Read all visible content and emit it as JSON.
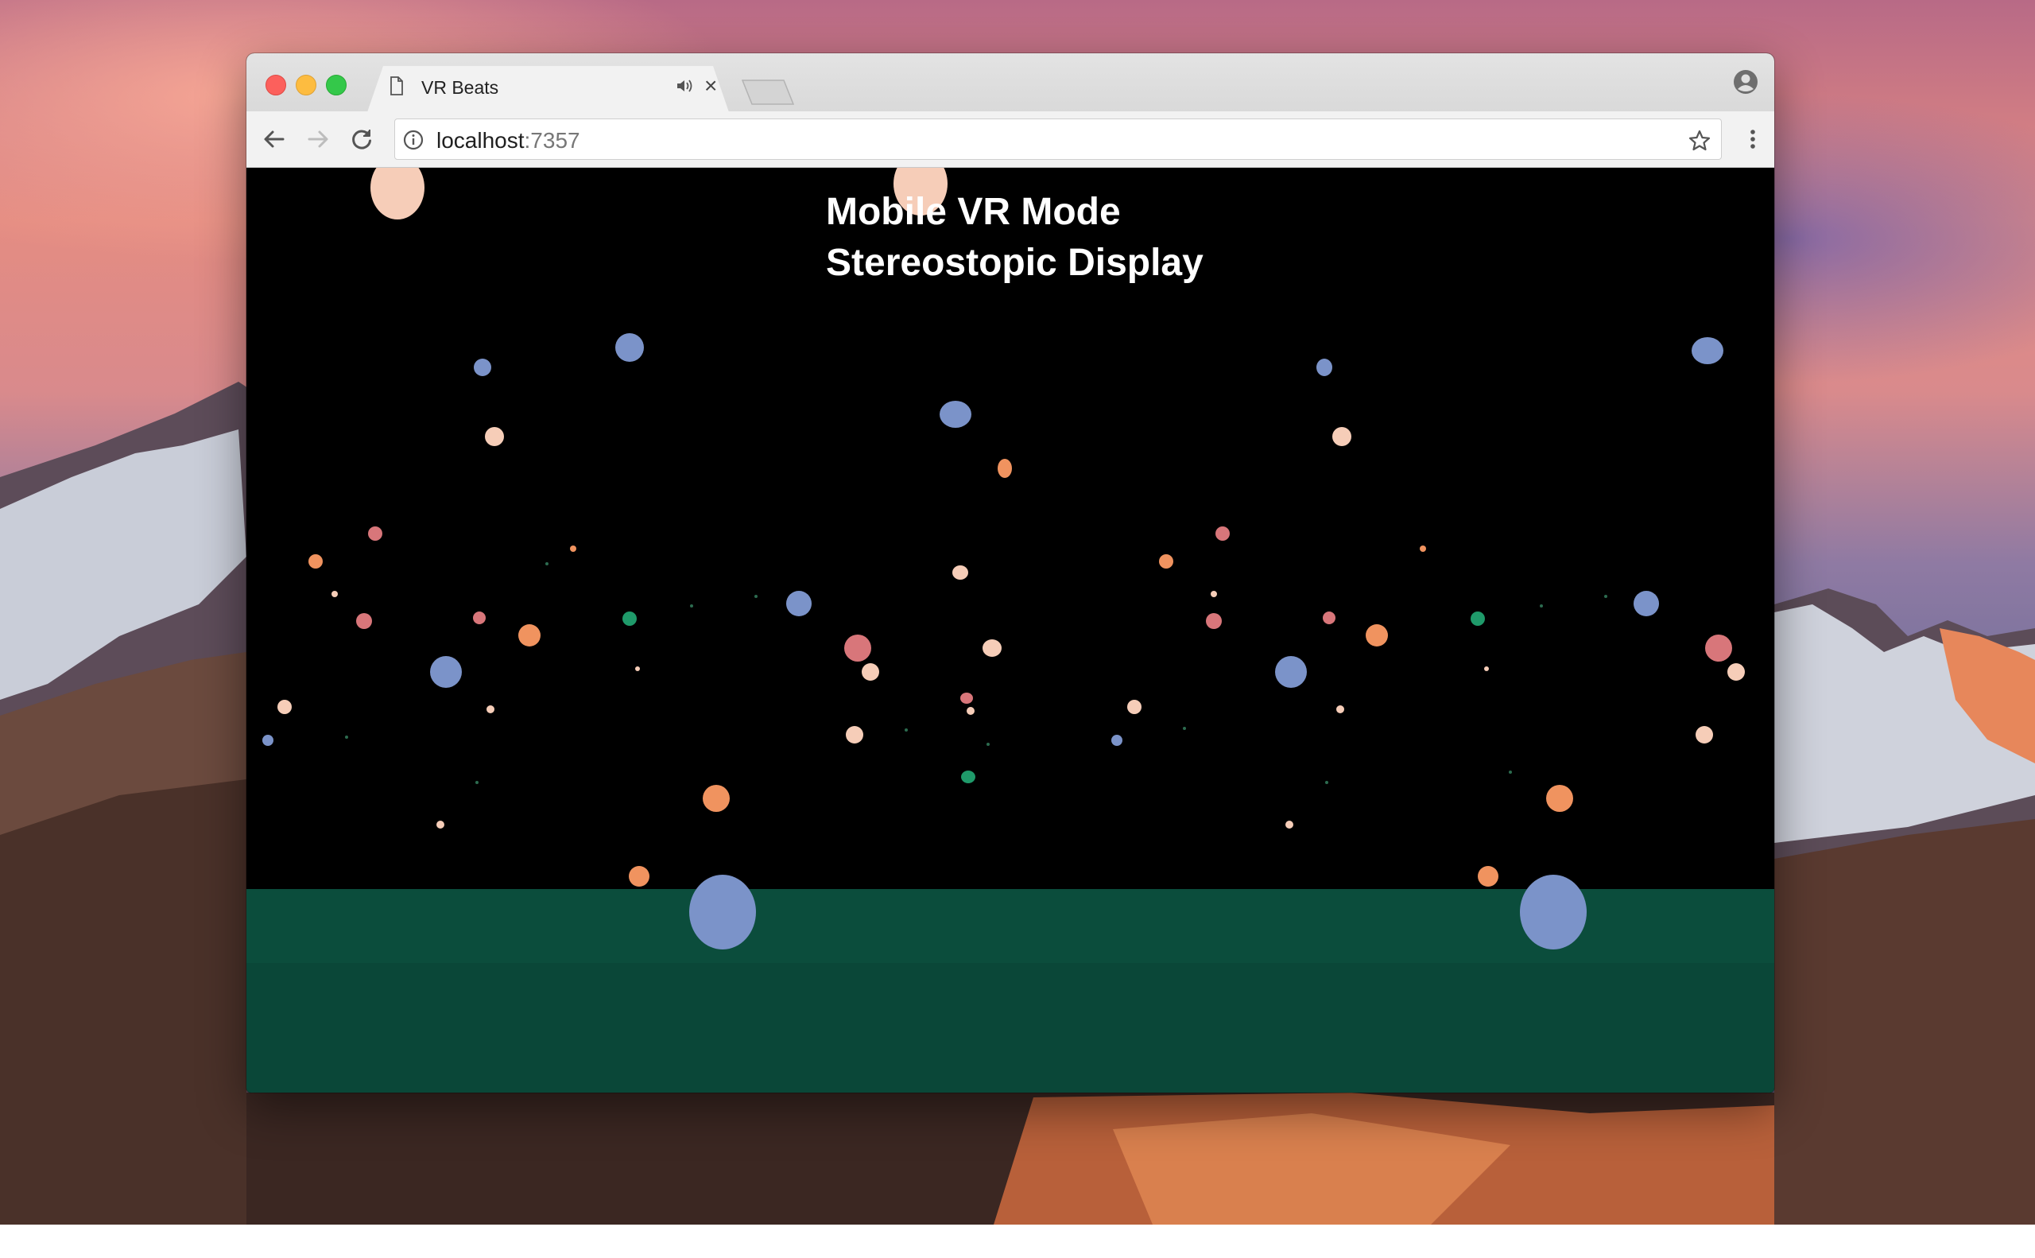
{
  "browser": {
    "tab": {
      "title": "VR Beats"
    },
    "address_bar": {
      "host": "localhost",
      "port": ":7357"
    }
  },
  "page": {
    "heading_line1": "Mobile VR Mode",
    "heading_line2": "Stereostopic Display"
  },
  "colors": {
    "floor": "#0b4d3c",
    "sky": "#000000",
    "orb_blue": "#7b93c9",
    "orb_orange": "#f0935f",
    "orb_peach": "#f6cdb8",
    "orb_pink": "#d8767a",
    "orb_green": "#1f9a6a"
  },
  "icons": {
    "tab_favicon": "document-icon",
    "tab_audio": "speaker-icon",
    "tab_close": "close-icon",
    "back": "back-arrow-icon",
    "forward": "forward-arrow-icon",
    "reload": "reload-icon",
    "site_info": "info-icon",
    "bookmark": "star-icon",
    "menu": "kebab-menu-icon",
    "profile": "profile-icon"
  }
}
